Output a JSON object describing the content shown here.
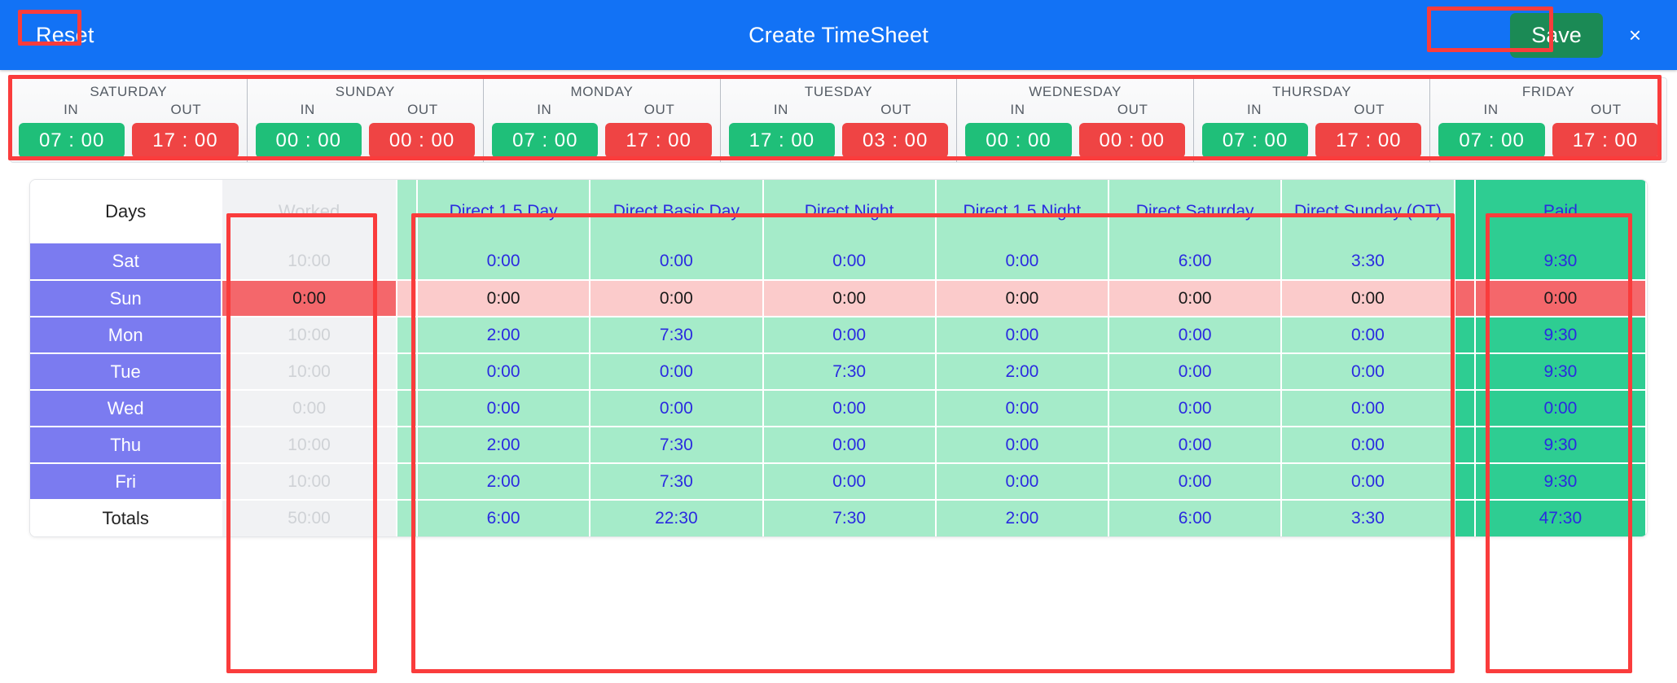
{
  "header": {
    "reset_label": "Reset",
    "title": "Create TimeSheet",
    "save_label": "Save",
    "close_label": "×"
  },
  "day_strip": {
    "in_label": "IN",
    "out_label": "OUT",
    "days": [
      {
        "name": "SATURDAY",
        "in": "07 : 00",
        "out": "17 : 00"
      },
      {
        "name": "SUNDAY",
        "in": "00 : 00",
        "out": "00 : 00"
      },
      {
        "name": "MONDAY",
        "in": "07 : 00",
        "out": "17 : 00"
      },
      {
        "name": "TUESDAY",
        "in": "17 : 00",
        "out": "03 : 00"
      },
      {
        "name": "WEDNESDAY",
        "in": "00 : 00",
        "out": "00 : 00"
      },
      {
        "name": "THURSDAY",
        "in": "07 : 00",
        "out": "17 : 00"
      },
      {
        "name": "FRIDAY",
        "in": "07 : 00",
        "out": "17 : 00"
      }
    ]
  },
  "table": {
    "headers": {
      "days": "Days",
      "worked": "Worked",
      "direct_15_day": "Direct 1.5 Day",
      "direct_basic_day": "Direct Basic Day",
      "direct_night": "Direct Night",
      "direct_15_night": "Direct 1.5 Night",
      "direct_saturday": "Direct Saturday",
      "direct_sunday_ot": "Direct Sunday (OT)",
      "paid": "Paid"
    },
    "rows": [
      {
        "day": "Sat",
        "worked": "10:00",
        "d15day": "0:00",
        "dbasic": "0:00",
        "dnight": "0:00",
        "d15night": "0:00",
        "dsat": "6:00",
        "dsun": "3:30",
        "paid": "9:30",
        "zero": false
      },
      {
        "day": "Sun",
        "worked": "0:00",
        "d15day": "0:00",
        "dbasic": "0:00",
        "dnight": "0:00",
        "d15night": "0:00",
        "dsat": "0:00",
        "dsun": "0:00",
        "paid": "0:00",
        "zero": true
      },
      {
        "day": "Mon",
        "worked": "10:00",
        "d15day": "2:00",
        "dbasic": "7:30",
        "dnight": "0:00",
        "d15night": "0:00",
        "dsat": "0:00",
        "dsun": "0:00",
        "paid": "9:30",
        "zero": false
      },
      {
        "day": "Tue",
        "worked": "10:00",
        "d15day": "0:00",
        "dbasic": "0:00",
        "dnight": "7:30",
        "d15night": "2:00",
        "dsat": "0:00",
        "dsun": "0:00",
        "paid": "9:30",
        "zero": false
      },
      {
        "day": "Wed",
        "worked": "0:00",
        "d15day": "0:00",
        "dbasic": "0:00",
        "dnight": "0:00",
        "d15night": "0:00",
        "dsat": "0:00",
        "dsun": "0:00",
        "paid": "0:00",
        "zero": false
      },
      {
        "day": "Thu",
        "worked": "10:00",
        "d15day": "2:00",
        "dbasic": "7:30",
        "dnight": "0:00",
        "d15night": "0:00",
        "dsat": "0:00",
        "dsun": "0:00",
        "paid": "9:30",
        "zero": false
      },
      {
        "day": "Fri",
        "worked": "10:00",
        "d15day": "2:00",
        "dbasic": "7:30",
        "dnight": "0:00",
        "d15night": "0:00",
        "dsat": "0:00",
        "dsun": "0:00",
        "paid": "9:30",
        "zero": false
      }
    ],
    "totals": {
      "label": "Totals",
      "worked": "50:00",
      "d15day": "6:00",
      "dbasic": "22:30",
      "dnight": "7:30",
      "d15night": "2:00",
      "dsat": "6:00",
      "dsun": "3:30",
      "paid": "47:30"
    }
  },
  "colors": {
    "header_blue": "#1272f5",
    "save_green": "#1b8a55",
    "in_green": "#1fbf79",
    "out_red": "#ef4444",
    "day_purple": "#7b7bf0",
    "direct_mint": "#a5ebc9",
    "paid_green": "#2ecd92",
    "zero_red": "#f4676b",
    "zero_pink": "#fbcbcb",
    "value_blue": "#2a2ae0",
    "annotation_red": "#fa3c3c"
  }
}
